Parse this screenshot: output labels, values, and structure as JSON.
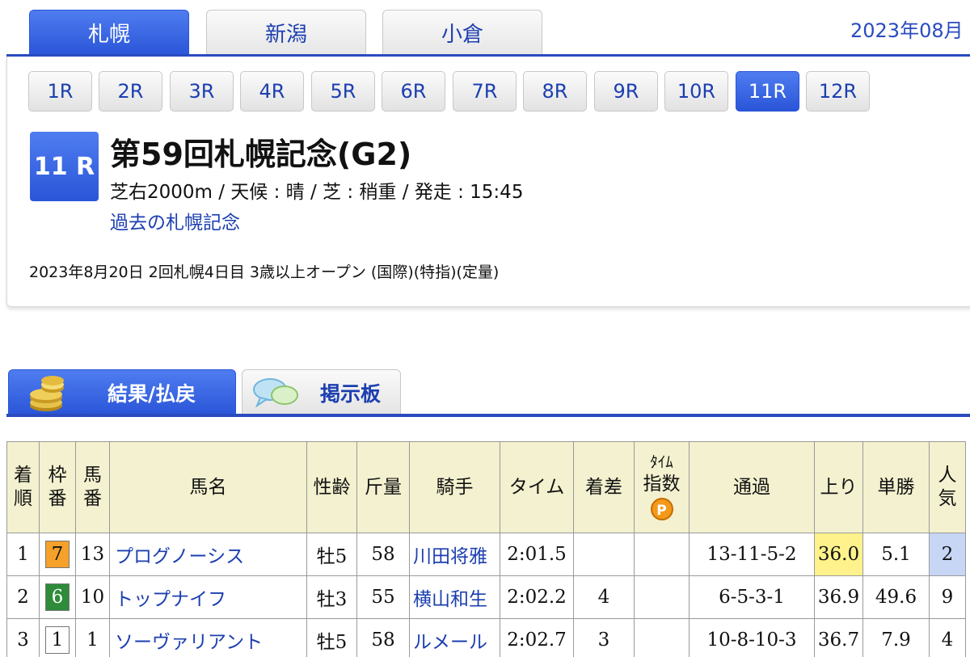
{
  "venues": [
    {
      "label": "札幌",
      "active": true
    },
    {
      "label": "新潟",
      "active": false
    },
    {
      "label": "小倉",
      "active": false
    }
  ],
  "date_text": "2023年08月",
  "races": [
    {
      "label": "1R",
      "active": false
    },
    {
      "label": "2R",
      "active": false
    },
    {
      "label": "3R",
      "active": false
    },
    {
      "label": "4R",
      "active": false
    },
    {
      "label": "5R",
      "active": false
    },
    {
      "label": "6R",
      "active": false
    },
    {
      "label": "7R",
      "active": false
    },
    {
      "label": "8R",
      "active": false
    },
    {
      "label": "9R",
      "active": false
    },
    {
      "label": "10R",
      "active": false
    },
    {
      "label": "11R",
      "active": true
    },
    {
      "label": "12R",
      "active": false
    }
  ],
  "race": {
    "badge": "11 R",
    "title": "第59回札幌記念(G2)",
    "conditions": "芝右2000m / 天候 : 晴 / 芝 : 稍重 / 発走 : 15:45",
    "past_link": "過去の札幌記念",
    "detail": "2023年8月20日 2回札幌4日目 3歳以上オープン  (国際)(特指)(定量)"
  },
  "content_tabs": [
    {
      "label": "結果/払戻",
      "icon": "coins-icon",
      "active": true
    },
    {
      "label": "掲示板",
      "icon": "chat-bubbles-icon",
      "active": false
    }
  ],
  "table": {
    "headers": {
      "rank": "着\n順",
      "waku": "枠\n番",
      "umaban": "馬\n番",
      "name": "馬名",
      "sexage": "性齢",
      "weight": "斤量",
      "jockey": "騎手",
      "time": "タイム",
      "margin": "着差",
      "index_top": "ﾀｲﾑ",
      "index_bottom": "指数",
      "index_badge": "P",
      "passing": "通過",
      "last3f": "上り",
      "odds": "単勝",
      "popularity": "人\n気"
    },
    "rows": [
      {
        "rank": "1",
        "waku": "7",
        "waku_bg": "#f5a12a",
        "waku_fg": "#111111",
        "umaban": "13",
        "name": "プログノーシス",
        "sexage": "牡5",
        "weight": "58",
        "jockey": "川田将雅",
        "time": "2:01.5",
        "margin": "",
        "index": "",
        "passing": "13-11-5-2",
        "last3f": "36.0",
        "last3f_highlight": true,
        "odds": "5.1",
        "popularity": "2",
        "popularity_highlight": true
      },
      {
        "rank": "2",
        "waku": "6",
        "waku_bg": "#2e8b3a",
        "waku_fg": "#ffffff",
        "umaban": "10",
        "name": "トップナイフ",
        "sexage": "牡3",
        "weight": "55",
        "jockey": "横山和生",
        "time": "2:02.2",
        "margin": "4",
        "index": "",
        "passing": "6-5-3-1",
        "last3f": "36.9",
        "last3f_highlight": false,
        "odds": "49.6",
        "popularity": "9",
        "popularity_highlight": false
      },
      {
        "rank": "3",
        "waku": "1",
        "waku_bg": "#ffffff",
        "waku_fg": "#111111",
        "umaban": "1",
        "name": "ソーヴァリアント",
        "sexage": "牡5",
        "weight": "58",
        "jockey": "ルメール",
        "time": "2:02.7",
        "margin": "3",
        "index": "",
        "passing": "10-8-10-3",
        "last3f": "36.7",
        "last3f_highlight": false,
        "odds": "7.9",
        "popularity": "4",
        "popularity_highlight": false
      }
    ]
  }
}
